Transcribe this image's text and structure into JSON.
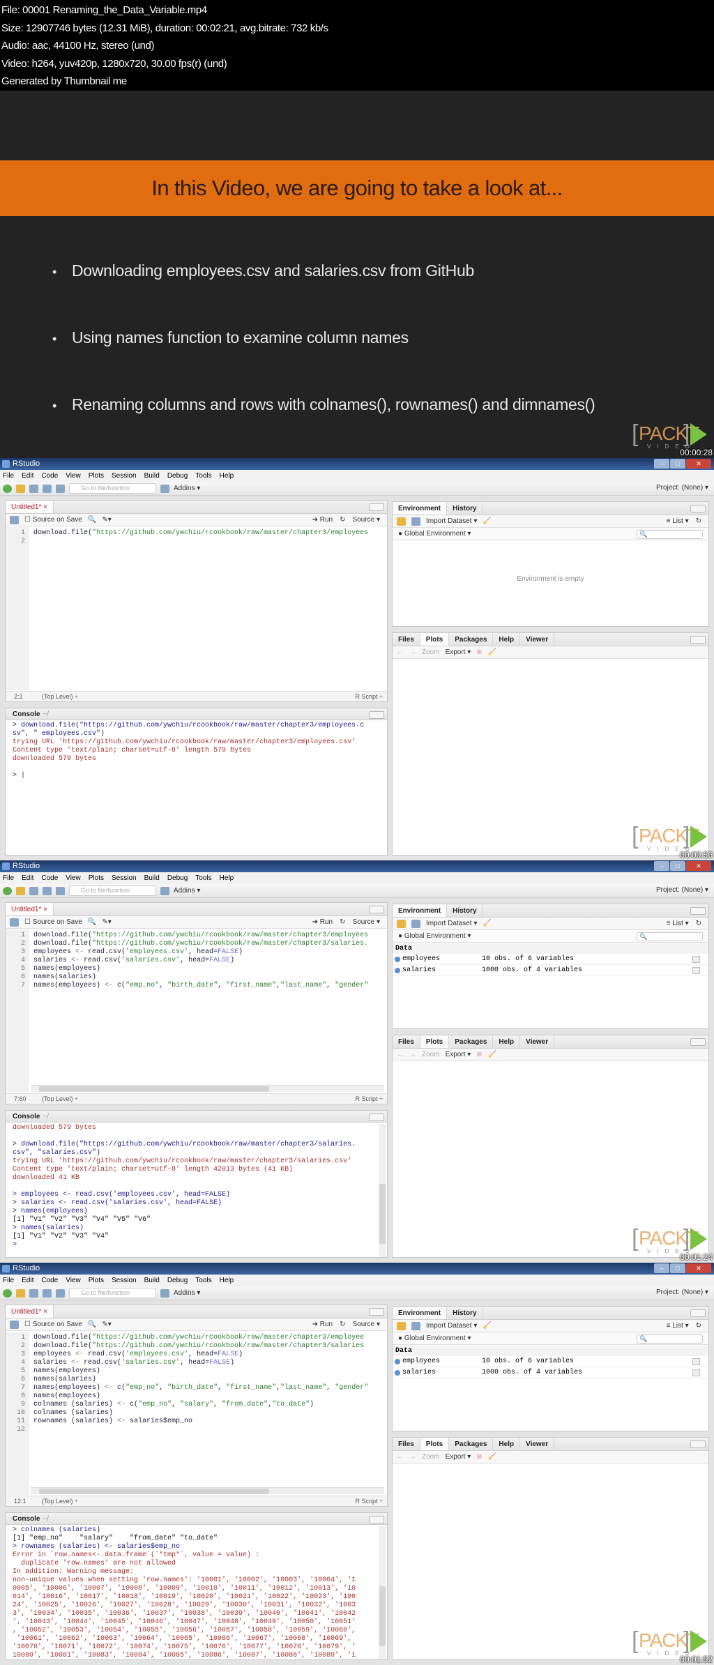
{
  "header": {
    "lines": [
      "File: 00001 Renaming_the_Data_Variable.mp4",
      "Size: 12907746 bytes (12.31 MiB), duration: 00:02:21, avg.bitrate: 732 kb/s",
      "Audio: aac, 44100 Hz, stereo (und)",
      "Video: h264, yuv420p, 1280x720, 30.00 fps(r) (und)",
      "Generated by Thumbnail me"
    ]
  },
  "slide": {
    "title": "In this Video, we are going to take a look at...",
    "bullets": [
      "Downloading employees.csv and salaries.csv from GitHub",
      "Using names function to examine column names",
      "Renaming columns and rows with colnames(), rownames() and dimnames()"
    ],
    "timestamp": "00:00:28"
  },
  "logo": {
    "text": "PACKT",
    "sub": "VIDEO"
  },
  "colors": {
    "accent": "#e06d10",
    "packt_green": "#7cc242",
    "titlebar": "#1c3664"
  },
  "app": {
    "title": "RStudio",
    "menu": [
      "File",
      "Edit",
      "Code",
      "View",
      "Plots",
      "Session",
      "Build",
      "Debug",
      "Tools",
      "Help"
    ],
    "goto_placeholder": "Go to file/function",
    "addins": "Addins ▾",
    "project": "Project: (None) ▾",
    "editor_tab": "Untitled1* ×",
    "source_on_save": "Source on Save",
    "run": "Run",
    "source": "Source ▾",
    "level": "(Top Level) ÷",
    "script_type": "R Script ÷",
    "console_title": "Console",
    "console_wd": "~/",
    "env_tabs": [
      "Environment",
      "History"
    ],
    "import_dataset": "Import Dataset ▾",
    "list_view": "List ▾",
    "global_env": "Global Environment ▾",
    "env_empty": "Environment is empty",
    "data_header": "Data",
    "files_tabs": [
      "Files",
      "Plots",
      "Packages",
      "Help",
      "Viewer"
    ],
    "zoom": "Zoom",
    "export": "Export ▾"
  },
  "frames": [
    {
      "timestamp": "00:00:56",
      "cursor": "2:1",
      "code": [
        "download.file(\"https://github.com/ywchiu/rcookbook/raw/master/chapter3/employees",
        ""
      ],
      "console": [
        {
          "t": "in",
          "s": "> download.file(\"https://github.com/ywchiu/rcookbook/raw/master/chapter3/employees.c"
        },
        {
          "t": "in",
          "s": "sv\", \" employees.csv\")"
        },
        {
          "t": "err",
          "s": "trying URL 'https://github.com/ywchiu/rcookbook/raw/master/chapter3/employees.csv'"
        },
        {
          "t": "err",
          "s": "Content type 'text/plain; charset=utf-8' length 579 bytes"
        },
        {
          "t": "err",
          "s": "downloaded 579 bytes"
        },
        {
          "t": "out",
          "s": ""
        },
        {
          "t": "in",
          "s": "> |"
        }
      ],
      "env": []
    },
    {
      "timestamp": "00:01:24",
      "cursor": "7:60",
      "code": [
        "download.file(\"https://github.com/ywchiu/rcookbook/raw/master/chapter3/employees",
        "download.file(\"https://github.com/ywchiu/rcookbook/raw/master/chapter3/salaries.",
        "employees <- read.csv('employees.csv', head=FALSE)",
        "salaries <- read.csv('salaries.csv', head=FALSE)",
        "names(employees)",
        "names(salaries)",
        "names(employees) <- c(\"emp_no\", \"birth_date\", \"first_name\",\"last_name\", \"gender\""
      ],
      "console": [
        {
          "t": "err",
          "s": "downloaded 579 bytes"
        },
        {
          "t": "out",
          "s": ""
        },
        {
          "t": "in",
          "s": "> download.file(\"https://github.com/ywchiu/rcookbook/raw/master/chapter3/salaries."
        },
        {
          "t": "in",
          "s": "csv\", \"salaries.csv\")"
        },
        {
          "t": "err",
          "s": "trying URL 'https://github.com/ywchiu/rcookbook/raw/master/chapter3/salaries.csv'"
        },
        {
          "t": "err",
          "s": "Content type 'text/plain; charset=utf-8' length 42013 bytes (41 KB)"
        },
        {
          "t": "err",
          "s": "downloaded 41 KB"
        },
        {
          "t": "out",
          "s": ""
        },
        {
          "t": "in",
          "s": "> employees <- read.csv('employees.csv', head=FALSE)"
        },
        {
          "t": "in",
          "s": "> salaries <- read.csv('salaries.csv', head=FALSE)"
        },
        {
          "t": "in",
          "s": "> names(employees)"
        },
        {
          "t": "out",
          "s": "[1] \"V1\" \"V2\" \"V3\" \"V4\" \"V5\" \"V6\""
        },
        {
          "t": "in",
          "s": "> names(salaries)"
        },
        {
          "t": "out",
          "s": "[1] \"V1\" \"V2\" \"V3\" \"V4\""
        },
        {
          "t": "in",
          "s": ">"
        }
      ],
      "env": [
        {
          "name": "employees",
          "value": "10 obs. of 6 variables"
        },
        {
          "name": "salaries",
          "value": "1000 obs. of 4 variables"
        }
      ]
    },
    {
      "timestamp": "00:01:52",
      "cursor": "12:1",
      "code": [
        "download.file(\"https://github.com/ywchiu/rcookbook/raw/master/chapter3/employee",
        "download.file(\"https://github.com/ywchiu/rcookbook/raw/master/chapter3/salaries",
        "employees <- read.csv('employees.csv', head=FALSE)",
        "salaries <- read.csv('salaries.csv', head=FALSE)",
        "names(employees)",
        "names(salaries)",
        "names(employees) <- c(\"emp_no\", \"birth_date\", \"first_name\",\"last_name\", \"gender\"",
        "names(employees)",
        "colnames (salaries) <- c(\"emp_no\", \"salary\", \"from_date\",\"to_date\")",
        "colnames (salaries)",
        "rownames (salaries) <- salaries$emp_no",
        ""
      ],
      "console": [
        {
          "t": "in",
          "s": "> colnames (salaries)"
        },
        {
          "t": "out",
          "s": "[1] \"emp_no\"    \"salary\"    \"from_date\" \"to_date\""
        },
        {
          "t": "in",
          "s": "> rownames (salaries) <- salaries$emp_no"
        },
        {
          "t": "err",
          "s": "Error in `row.names<-.data.frame`(`*tmp*`, value = value) :"
        },
        {
          "t": "err",
          "s": "  duplicate 'row.names' are not allowed"
        },
        {
          "t": "err",
          "s": "In addition: Warning message:"
        },
        {
          "t": "err",
          "s": "non-unique values when setting 'row.names': '10001', '10002', '10003', '10004', '1"
        },
        {
          "t": "err",
          "s": "0005', '10006', '10007', '10008', '10009', '10010', '10011', '10012', '10013', '10"
        },
        {
          "t": "err",
          "s": "014', '10016', '10017', '10018', '10019', '10020', '10021', '10022', '10023', '100"
        },
        {
          "t": "err",
          "s": "24', '10025', '10026', '10027', '10028', '10029', '10030', '10031', '10032', '1003"
        },
        {
          "t": "err",
          "s": "3', '10034', '10035', '10036', '10037', '10038', '10039', '10040', '10041', '10042"
        },
        {
          "t": "err",
          "s": "', '10043', '10044', '10045', '10046', '10047', '10048', '10049', '10050', '10051'"
        },
        {
          "t": "err",
          "s": ", '10052', '10053', '10054', '10055', '10056', '10057', '10058', '10059', '10060',"
        },
        {
          "t": "err",
          "s": " '10061', '10062', '10063', '10064', '10065', '10066', '10067', '10068', '10069',"
        },
        {
          "t": "err",
          "s": "'10070', '10071', '10072', '10074', '10075', '10076', '10077', '10078', '10079', '"
        },
        {
          "t": "err",
          "s": "10080', '10081', '10083', '10084', '10085', '10086', '10087', '10088', '10089', '1"
        }
      ],
      "env": [
        {
          "name": "employees",
          "value": "10 obs. of 6 variables"
        },
        {
          "name": "salaries",
          "value": "1000 obs. of 4 variables"
        }
      ]
    }
  ]
}
